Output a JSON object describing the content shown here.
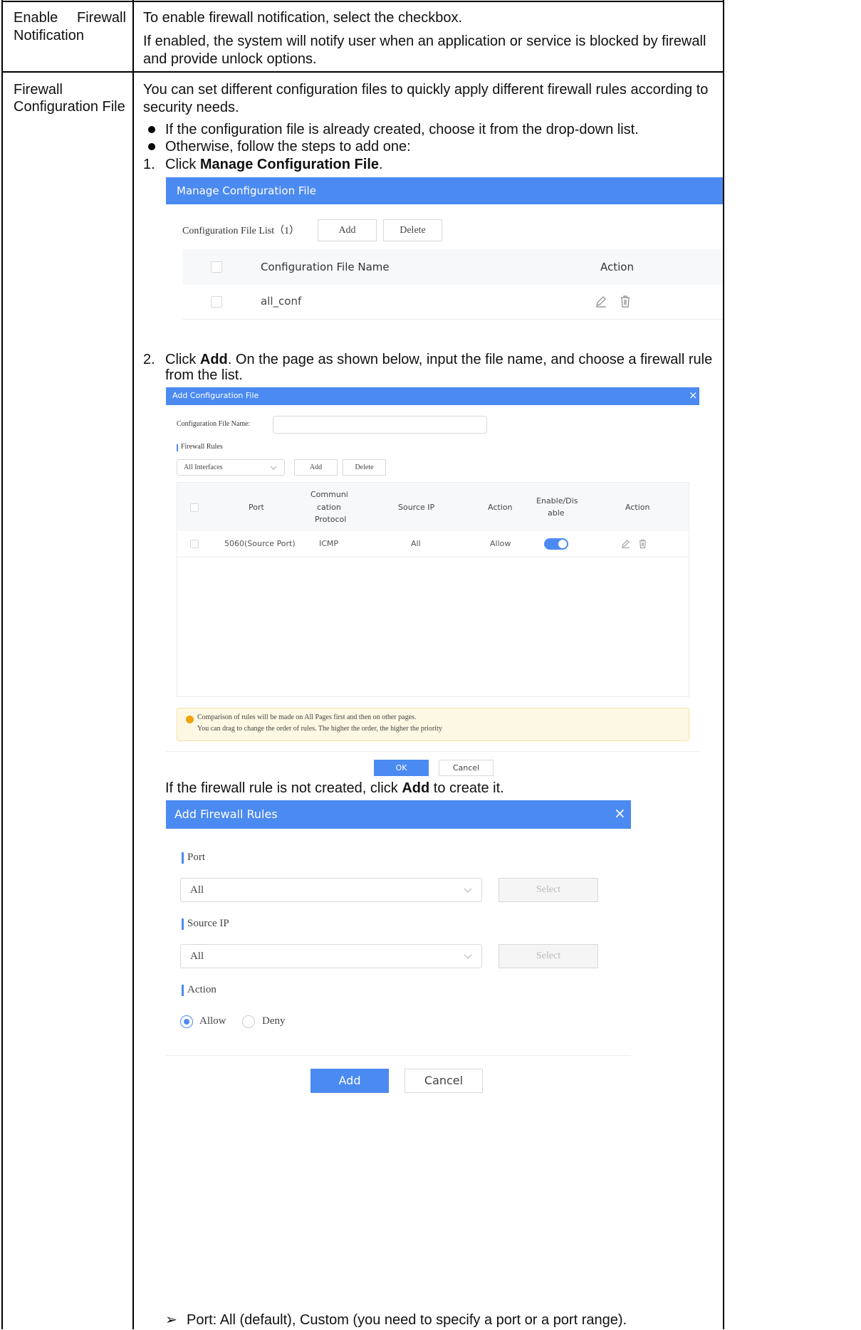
{
  "row1": {
    "label_1": "Enable",
    "label_2": "Firewall",
    "label_3": "Notification",
    "text_1": "To enable firewall notification, select the checkbox.",
    "text_2": "If enabled, the system will notify user when an application or service is blocked by firewall",
    "text_3": "and provide unlock options."
  },
  "row2": {
    "label_1": "Firewall",
    "label_2": "Configuration File",
    "intro_1": "You can set different configuration files to quickly apply different firewall rules according to",
    "intro_2": "security needs.",
    "bullet_1": "If the configuration file is already created, choose it from the drop-down list.",
    "bullet_2": "Otherwise, follow the steps to add one:",
    "step1_num": "1.",
    "step1_pre": "Click ",
    "step1_bold": "Manage Configuration File",
    "step1_post": ".",
    "step2_num": "2.",
    "step2_pre": "Click ",
    "step2_bold": "Add",
    "step2_post": ". On the page as shown below, input the file name, and choose a firewall rule",
    "step2_line2": "from the list.",
    "note_pre": "If the firewall rule is not created, click ",
    "note_bold": "Add",
    "note_post": " to create it.",
    "port_note": "Port: All (default), Custom (you need to specify a port or a port range).",
    "arrow": "➢"
  },
  "manage_dialog": {
    "title": "Manage Configuration File",
    "list_label": "Configuration File List（1）",
    "add_label": "Add",
    "delete_label": "Delete",
    "col_name": "Configuration File Name",
    "col_action": "Action",
    "rows": [
      {
        "name": "all_conf"
      }
    ]
  },
  "add_config_dialog": {
    "title": "Add Configuration File",
    "close": "×",
    "name_label": "Configuration File Name:",
    "name_value": "",
    "section": "Firewall Rules",
    "iface_select": "All Interfaces",
    "add_label": "Add",
    "delete_label": "Delete",
    "headers": {
      "port": "Port",
      "protocol_1": "Communi",
      "protocol_2": "cation",
      "protocol_3": "Protocol",
      "source_ip": "Source IP",
      "action": "Action",
      "enable_1": "Enable/Dis",
      "enable_2": "able",
      "ops": "Action"
    },
    "rule": {
      "port": "5060(Source Port)",
      "protocol": "ICMP",
      "source_ip": "All",
      "action": "Allow",
      "enabled": true
    },
    "tip_1": "Comparison of rules will be made on All Pages first and then on other pages.",
    "tip_2": "You can drag to change the order of rules. The higher the order, the higher the priority",
    "ok_label": "OK",
    "cancel_label": "Cancel",
    "accent": "#4b8af0",
    "tip_bg": "#fdf8e3",
    "tip_icon_color": "#f0a30a"
  },
  "add_rules_dialog": {
    "title": "Add Firewall Rules",
    "close": "×",
    "port_section": "Port",
    "port_value": "All",
    "select_label": "Select",
    "source_section": "Source IP",
    "source_value": "All",
    "action_section": "Action",
    "allow_label": "Allow",
    "deny_label": "Deny",
    "selected_action": "Allow",
    "add_label": "Add",
    "cancel_label": "Cancel"
  }
}
